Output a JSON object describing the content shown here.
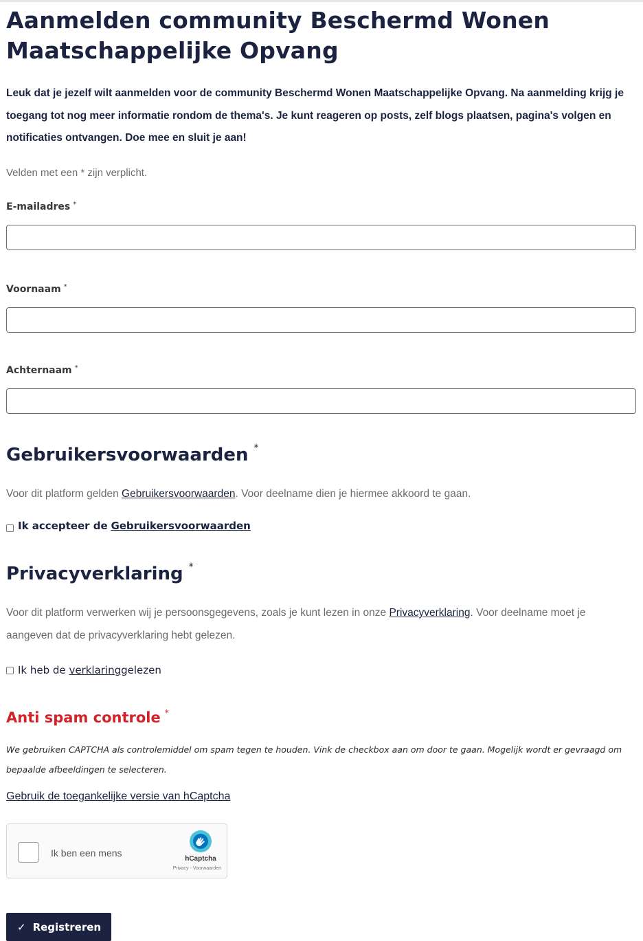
{
  "page": {
    "title": "Aanmelden community Beschermd Wonen Maatschappelijke Opvang",
    "intro": "Leuk dat je jezelf wilt aanmelden voor de community Beschermd Wonen Maatschappelijke Opvang. Na aanmelding krijg je toegang tot nog meer informatie rondom de thema's. Je kunt reageren op posts, zelf blogs plaatsen, pagina's volgen en notificaties ontvangen. Doe mee en sluit je aan!",
    "required_note": "Velden met een * zijn verplicht."
  },
  "form": {
    "required_marker": "*",
    "fields": [
      {
        "label": "E-mailadres",
        "value": "",
        "placeholder": ""
      },
      {
        "label": "Voornaam",
        "value": "",
        "placeholder": ""
      },
      {
        "label": "Achternaam",
        "value": "",
        "placeholder": ""
      }
    ]
  },
  "terms": {
    "heading": "Gebruikersvoorwaarden",
    "text_before": "Voor dit platform gelden ",
    "link": "Gebruikersvoorwaarden",
    "text_after": ". Voor deelname dien je hiermee akkoord te gaan.",
    "checkbox_label": "Ik accepteer de ",
    "checkbox_link": "Gebruikersvoorwaarden",
    "checked": false
  },
  "privacy": {
    "heading": "Privacyverklaring",
    "text_before": "Voor dit platform verwerken wij je persoonsgegevens, zoals je kunt lezen in onze ",
    "link": "Privacyverklaring",
    "text_after": ". Voor deelname moet je aangeven dat de privacyverklaring hebt gelezen.",
    "checkbox_label": "Ik heb de ",
    "checkbox_link": "verklaring",
    "checkbox_after": "gelezen",
    "checked": false
  },
  "spam": {
    "heading": "Anti spam controle",
    "text": "We gebruiken CAPTCHA als controlemiddel om spam tegen te houden. Vink de checkbox aan om door te gaan. Mogelijk wordt er gevraagd om bepaalde afbeeldingen te selecteren.",
    "accessible_link": "Gebruik de toegankelijke versie van hCaptcha",
    "captcha_label": "Ik ben een mens",
    "captcha_brand": "hCaptcha",
    "captcha_links": "Privacy - Voorwaarden",
    "colors": {
      "heading": "#d2232a",
      "accent": "#1c2340"
    }
  },
  "submit": {
    "icon": "checkmark-icon",
    "label": "Registreren"
  }
}
